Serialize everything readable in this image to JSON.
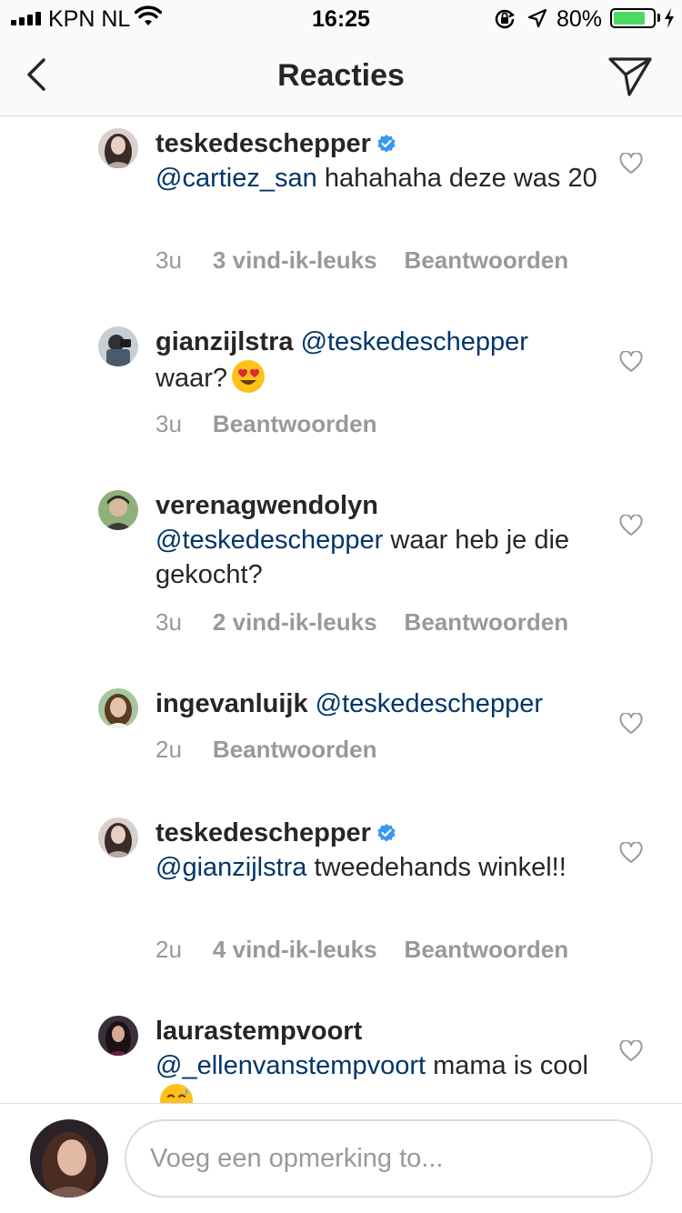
{
  "status_bar": {
    "carrier": "KPN NL",
    "time": "16:25",
    "battery_percent": "80%",
    "battery_level": 0.8,
    "battery_color": "#4cd964"
  },
  "header": {
    "title": "Reacties",
    "back_icon": "chevron-left-icon",
    "send_icon": "paper-plane-icon"
  },
  "colors": {
    "mention": "#003569",
    "meta": "#999999",
    "verified": "#3897f0",
    "text": "#262626"
  },
  "comments": [
    {
      "username": "teskedeschepper",
      "verified": true,
      "mention": "@cartiez_san",
      "text": "hahahaha deze was 20",
      "time": "3u",
      "likes": "3 vind-ik-leuks",
      "reply": "Beantwoorden"
    },
    {
      "username": "gianzijlstra",
      "verified": false,
      "mention": "@teskedeschepper",
      "text": "waar?",
      "emoji": "heart-eyes-emoji",
      "time": "3u",
      "reply": "Beantwoorden"
    },
    {
      "username": "verenagwendolyn",
      "verified": false,
      "mention": "@teskedeschepper",
      "text": " waar heb je die gekocht?",
      "time": "3u",
      "likes": "2 vind-ik-leuks",
      "reply": "Beantwoorden"
    },
    {
      "username": "ingevanluijk",
      "verified": false,
      "mention": "@teskedeschepper",
      "text": "",
      "time": "2u",
      "reply": "Beantwoorden"
    },
    {
      "username": "teskedeschepper",
      "verified": true,
      "mention": "@gianzijlstra",
      "text": "tweedehands winkel!!",
      "time": "2u",
      "likes": "4 vind-ik-leuks",
      "reply": "Beantwoorden"
    },
    {
      "username": "laurastempvoort",
      "verified": false,
      "mention": "@_ellenvanstempvoort",
      "text": "mama is cool",
      "emoji": "grinning-sweat-emoji"
    }
  ],
  "footer": {
    "placeholder": "Voeg een opmerking to..."
  }
}
